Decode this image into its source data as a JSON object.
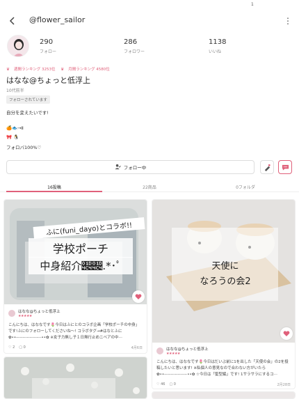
{
  "status": {
    "number": "1"
  },
  "header": {
    "username": "@flower_sailor",
    "back_icon": "back-arrow-icon",
    "more_icon": "more-vertical-icon"
  },
  "stats": [
    {
      "num": "290",
      "label": "フォロー"
    },
    {
      "num": "286",
      "label": "フォロワー"
    },
    {
      "num": "1138",
      "label": "いいね"
    }
  ],
  "ranks": {
    "weekly": "週間ランキング 3253位",
    "monthly": "月間ランキング 4580位"
  },
  "profile": {
    "display_name": "はなな@ちょっと低浮上",
    "age": "10代前半",
    "followed_badge": "フォローされています",
    "bio_1": "自分を変えたいです!",
    "bio_2": "🍊🐟→Ⅱ",
    "bio_3": "🎀 🐧",
    "bio_4": "フォロバ100%♡"
  },
  "actions": {
    "follow_label": "フォロー中"
  },
  "tabs": [
    {
      "label": "16投稿",
      "active": true
    },
    {
      "label": "22商品",
      "active": false
    },
    {
      "label": "0フォルダ",
      "active": false
    }
  ],
  "posts": [
    {
      "overlay_1": "ふに(funi_dayo)とコラボ!!",
      "overlay_2": "学校ポーチ",
      "overlay_3": "中身紹介𝓄𝓄.*･ﾟ",
      "author": "はなな@ちょっと低浮上",
      "stars": "★★★★★",
      "desc": "こんにちは、はななです🌷今日はふにとのコラボ企画「学校ポーチの中身」です!ふにのフォローしてくださいね〜! コラボタグ→#はなとふに ✿••┈┈┈┈┈┈┈┈┈┈┈••✿ ※女子力無し子１日無行止めニベアの中⋯",
      "likes": "2",
      "comments": "0",
      "date": "4月6日"
    },
    {
      "overlay_1": "天使に",
      "overlay_2": "なろうの会2",
      "author": "はなな@ちょっと低浮上",
      "stars": "★★★★★",
      "desc": "こんにちは、はななです🌷今日はだいぶ前に1を出した「天使の会」の2を投稿したいと思います! ※私個人の意見なので合わない方がいたら ✿••┈┈┈┈┈┈┈┈┈┈••✿ ☆今日は「髪型編」です! 1サラサラにするコ⋯",
      "likes": "46",
      "comments": "0",
      "date": "2月28日"
    }
  ],
  "colors": {
    "accent": "#e0607a"
  }
}
